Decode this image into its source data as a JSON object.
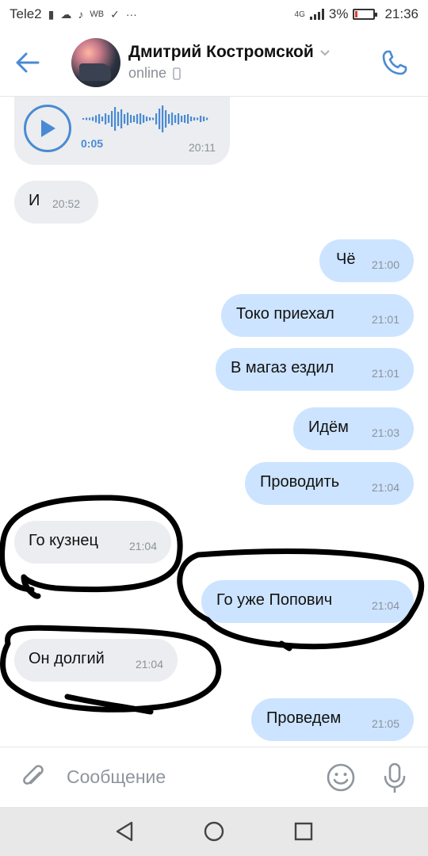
{
  "status_bar": {
    "carrier": "Tele2",
    "notif_text": "WB",
    "network": "4G",
    "battery": "3%",
    "time": "21:36"
  },
  "header": {
    "name": "Дмитрий Костромской",
    "status": "online"
  },
  "voice_message": {
    "duration": "0:05",
    "time": "20:11"
  },
  "messages": [
    {
      "dir": "in",
      "text": "И",
      "time": "20:52"
    },
    {
      "dir": "out",
      "text": "Чё",
      "time": "21:00"
    },
    {
      "dir": "out",
      "text": "Токо приехал",
      "time": "21:01"
    },
    {
      "dir": "out",
      "text": "В магаз ездил",
      "time": "21:01"
    },
    {
      "dir": "out",
      "text": "Идём",
      "time": "21:03"
    },
    {
      "dir": "out",
      "text": "Проводить",
      "time": "21:04"
    },
    {
      "dir": "in",
      "text": "Го кузнец",
      "time": "21:04"
    },
    {
      "dir": "out",
      "text": "Го уже Попович",
      "time": "21:04"
    },
    {
      "dir": "in",
      "text": "Он долгий",
      "time": "21:04"
    },
    {
      "dir": "out",
      "text": "Проведем",
      "time": "21:05"
    }
  ],
  "input": {
    "placeholder": "Сообщение"
  },
  "icons": {
    "back": "back-arrow-icon",
    "call": "phone-icon",
    "attach": "paperclip-icon",
    "emoji": "smiley-icon",
    "mic": "microphone-icon",
    "nav_back": "triangle-back-icon",
    "nav_home": "circle-home-icon",
    "nav_recents": "square-recents-icon"
  },
  "colors": {
    "accent": "#4a8ad3",
    "incoming_bubble": "#ebedf0",
    "outgoing_bubble": "#cce4ff",
    "battery_low": "#e53935"
  }
}
